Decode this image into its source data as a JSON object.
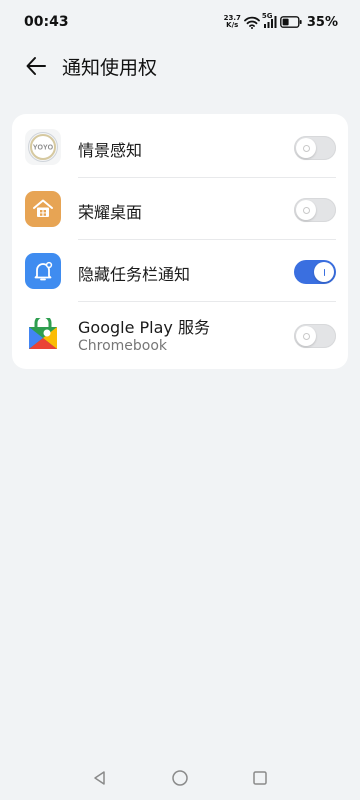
{
  "status_bar": {
    "time": "00:43",
    "net_speed_value": "23.7",
    "net_speed_unit": "K/s",
    "network": "5G",
    "battery": "35%"
  },
  "header": {
    "title": "通知使用权",
    "back_icon": "back-arrow-icon"
  },
  "apps": [
    {
      "name": "情景感知",
      "subtitle": "",
      "enabled": false,
      "icon": "yoyo-icon"
    },
    {
      "name": "荣耀桌面",
      "subtitle": "",
      "enabled": false,
      "icon": "home-icon"
    },
    {
      "name": "隐藏任务栏通知",
      "subtitle": "",
      "enabled": true,
      "icon": "bell-icon"
    },
    {
      "name": "Google Play 服务",
      "subtitle": "Chromebook",
      "enabled": false,
      "icon": "google-play-services-icon"
    }
  ],
  "colors": {
    "accent": "#3a6fe0",
    "background": "#f1f3f5",
    "card": "#ffffff"
  },
  "icon_labels": {
    "yoyo": "YOYO"
  }
}
